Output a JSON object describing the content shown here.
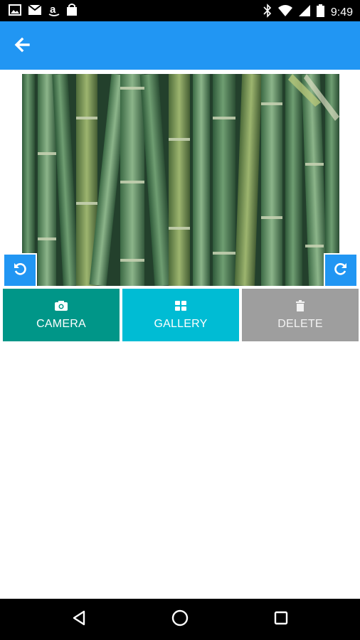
{
  "status_bar": {
    "time": "9:49",
    "left_icons": [
      "image-icon",
      "mail-icon",
      "amazon-icon",
      "shopping-bag-icon"
    ],
    "right_icons": [
      "bluetooth-icon",
      "wifi-icon",
      "signal-icon",
      "battery-icon"
    ]
  },
  "app_bar": {
    "color": "#2196f3",
    "back_icon": "arrow-left-icon"
  },
  "photo": {
    "subject": "bamboo"
  },
  "rotate": {
    "left_icon": "rotate-left-icon",
    "right_icon": "rotate-right-icon"
  },
  "actions": {
    "camera": {
      "label": "CAMERA",
      "icon": "camera-icon",
      "color": "#009688"
    },
    "gallery": {
      "label": "GALLERY",
      "icon": "grid-icon",
      "color": "#00bcd4"
    },
    "delete": {
      "label": "DELETE",
      "icon": "trash-icon",
      "color": "#9e9e9e"
    }
  },
  "nav_bar": {
    "icons": [
      "back-triangle-icon",
      "home-circle-icon",
      "recents-square-icon"
    ]
  }
}
